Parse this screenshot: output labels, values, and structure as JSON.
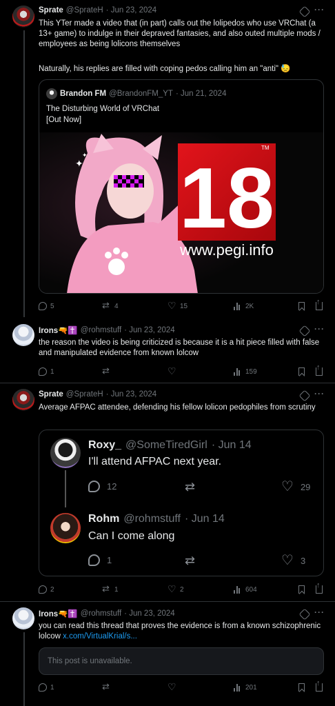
{
  "tweets": [
    {
      "name": "Sprate",
      "handle": "@SprateH",
      "date": "· Jun 23, 2024",
      "text": "This YTer made a video that (in part) calls out the lolipedos who use VRChat (a 13+ game) to indulge in their depraved fantasies, and also outed multiple mods / employees as being lolicons themselves",
      "text2": "Naturally, his replies are filled with coping pedos calling him an \"anti\" 😓",
      "quote": {
        "name": "Brandon FM",
        "handle": "@BrandonFM_YT",
        "date": "· Jun 21, 2024",
        "line1": "The Disturbing World of VRChat",
        "line2": "[Out Now]",
        "badge_number": "18",
        "badge_tm": "TM",
        "badge_url": "www.pegi.info"
      },
      "stats": {
        "replies": "5",
        "reposts": "4",
        "likes": "15",
        "views": "2K"
      }
    },
    {
      "name": "Irons🔫✝️",
      "handle": "@rohmstuff",
      "date": "· Jun 23, 2024",
      "text": "the reason the video is being criticized is because it is a hit piece filled with false and manipulated evidence from known lolcow",
      "stats": {
        "replies": "1",
        "reposts": "",
        "likes": "",
        "views": "159"
      }
    },
    {
      "name": "Sprate",
      "handle": "@SprateH",
      "date": "· Jun 23, 2024",
      "text": "Average AFPAC attendee, defending his fellow lolicon pedophiles from scrutiny",
      "embed": [
        {
          "name": "Roxy_",
          "handle": "@SomeTiredGirl",
          "date": "· Jun 14",
          "text": "I'll attend AFPAC next year.",
          "replies": "12",
          "reposts": "",
          "likes": "29"
        },
        {
          "name": "Rohm",
          "handle": "@rohmstuff",
          "date": "· Jun 14",
          "text": "Can I come along",
          "replies": "1",
          "reposts": "",
          "likes": "3"
        }
      ],
      "stats": {
        "replies": "2",
        "reposts": "1",
        "likes": "2",
        "views": "604"
      }
    },
    {
      "name": "Irons🔫✝️",
      "handle": "@rohmstuff",
      "date": "· Jun 23, 2024",
      "text": "you can read this thread that proves the evidence is from a known schizophrenic lolcow ",
      "link": "x.com/VirtualKrial/s...",
      "unavailable": "This post is unavailable.",
      "stats": {
        "replies": "1",
        "reposts": "",
        "likes": "",
        "views": "201"
      }
    }
  ]
}
